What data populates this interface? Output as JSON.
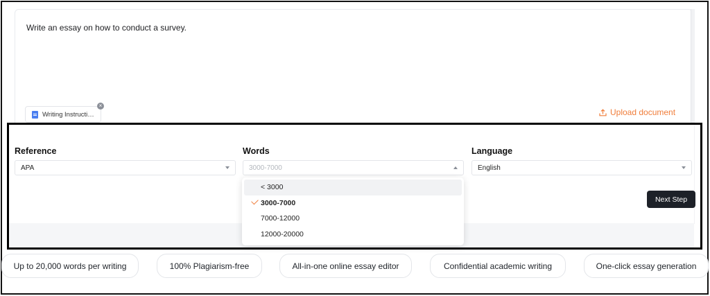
{
  "prompt": {
    "text": "Write an essay on how to conduct a survey.",
    "attachment_label": "Writing Instructi…",
    "attachment_remove": "×",
    "upload_label": "Upload document"
  },
  "settings": {
    "reference": {
      "label": "Reference",
      "value": "APA"
    },
    "words": {
      "label": "Words",
      "placeholder": "3000-7000",
      "options": [
        "< 3000",
        "3000-7000",
        "7000-12000",
        "12000-20000"
      ],
      "selected": "3000-7000",
      "hovered": "< 3000"
    },
    "language": {
      "label": "Language",
      "value": "English"
    },
    "next_label": "Next Step"
  },
  "features": [
    "Up to 20,000 words per writing",
    "100% Plagiarism-free",
    "All-in-one online essay editor",
    "Confidential academic writing",
    "One-click essay generation"
  ],
  "colors": {
    "accent": "#f07d3a",
    "button_dark": "#1d2128",
    "doc_icon": "#4a7ef0"
  },
  "icons": [
    "doc-icon",
    "close-icon",
    "upload-icon",
    "chevron-down-icon",
    "chevron-up-icon",
    "check-icon"
  ]
}
